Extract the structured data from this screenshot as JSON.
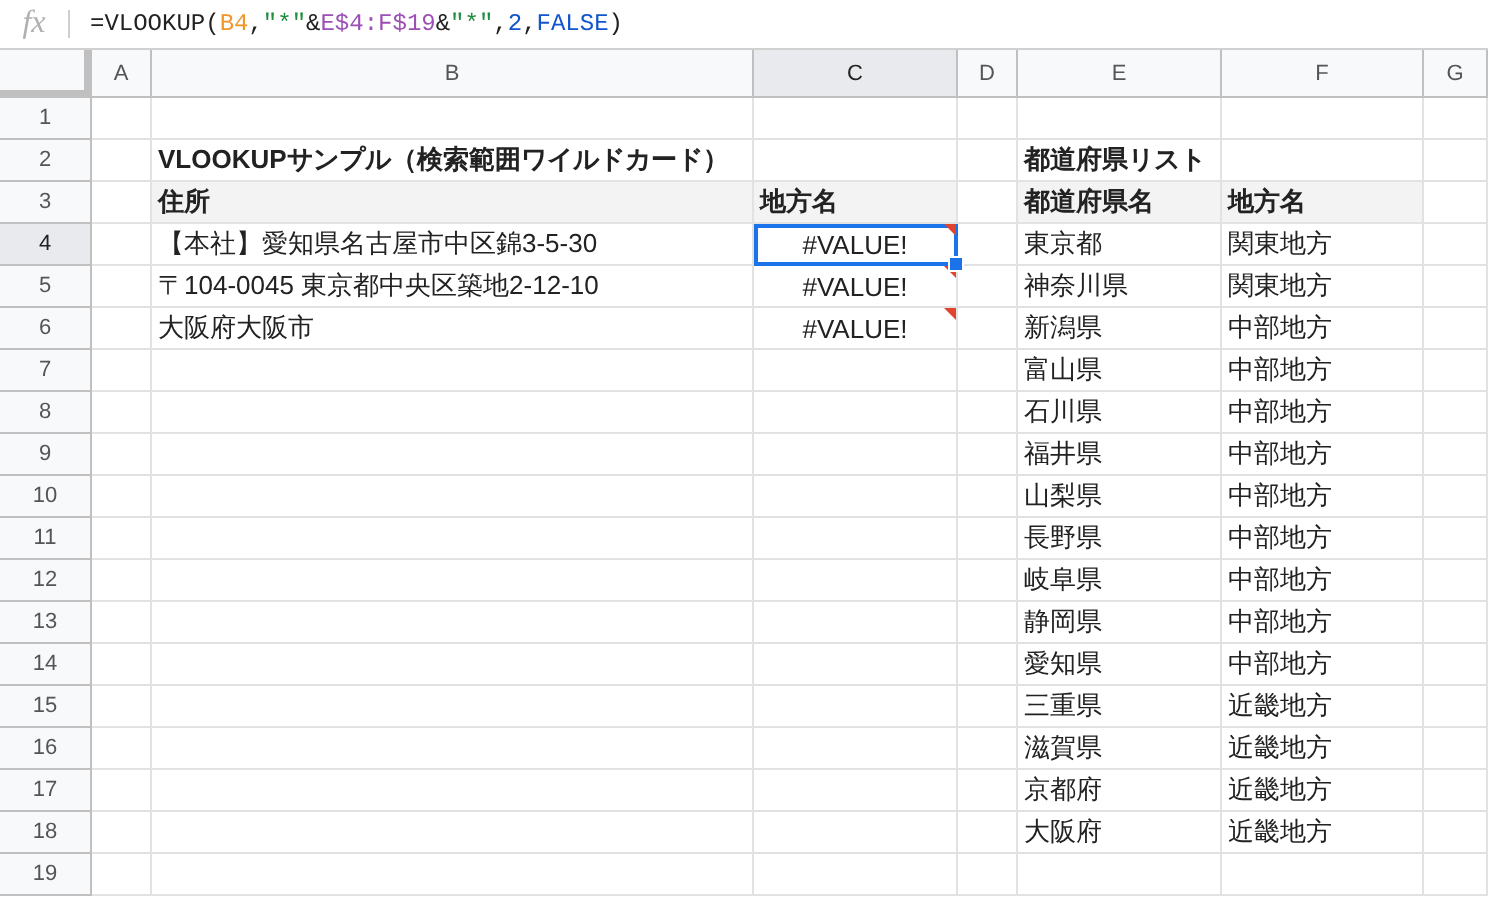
{
  "formula_bar": {
    "label": "fx",
    "tokens": [
      {
        "kind": "text",
        "text": "=VLOOKUP("
      },
      {
        "kind": "ref",
        "text": "B4",
        "color": "#f0962a"
      },
      {
        "kind": "text",
        "text": ","
      },
      {
        "kind": "string",
        "text": "\"*\""
      },
      {
        "kind": "text",
        "text": "&"
      },
      {
        "kind": "ref",
        "text": "E$4:F$19",
        "color": "#9c4fb5"
      },
      {
        "kind": "text",
        "text": "&"
      },
      {
        "kind": "string",
        "text": "\"*\""
      },
      {
        "kind": "text",
        "text": ","
      },
      {
        "kind": "number",
        "text": "2"
      },
      {
        "kind": "text",
        "text": ","
      },
      {
        "kind": "number",
        "text": "FALSE"
      },
      {
        "kind": "text",
        "text": ")"
      }
    ]
  },
  "columns": [
    {
      "label": "A",
      "selected": false
    },
    {
      "label": "B",
      "selected": false
    },
    {
      "label": "C",
      "selected": true
    },
    {
      "label": "D",
      "selected": false
    },
    {
      "label": "E",
      "selected": false
    },
    {
      "label": "F",
      "selected": false
    },
    {
      "label": "G",
      "selected": false
    }
  ],
  "rows": [
    {
      "number": "1",
      "selected": false,
      "cells": {}
    },
    {
      "number": "2",
      "selected": false,
      "cells": {
        "B": {
          "kind": "title",
          "text": "VLOOKUPサンプル（検索範囲ワイルドカード）",
          "selected": false
        },
        "E": {
          "kind": "title",
          "text": "都道府県リスト",
          "selected": false
        }
      }
    },
    {
      "number": "3",
      "selected": false,
      "cells": {
        "B": {
          "kind": "header",
          "text": "住所",
          "selected": false
        },
        "C": {
          "kind": "header",
          "text": "地方名",
          "selected": false
        },
        "E": {
          "kind": "header",
          "text": "都道府県名",
          "selected": false
        },
        "F": {
          "kind": "header",
          "text": "地方名",
          "selected": false
        }
      }
    },
    {
      "number": "4",
      "selected": true,
      "cells": {
        "B": {
          "kind": "text",
          "text": "【本社】愛知県名古屋市中区錦3-5-30",
          "selected": false
        },
        "C": {
          "kind": "error",
          "text": "#VALUE!",
          "selected": true
        },
        "E": {
          "kind": "text",
          "text": "東京都",
          "selected": false
        },
        "F": {
          "kind": "text",
          "text": "関東地方",
          "selected": false
        }
      }
    },
    {
      "number": "5",
      "selected": false,
      "cells": {
        "B": {
          "kind": "text",
          "text": "〒104-0045 東京都中央区築地2-12-10",
          "selected": false
        },
        "C": {
          "kind": "error",
          "text": "#VALUE!",
          "selected": false
        },
        "E": {
          "kind": "text",
          "text": "神奈川県",
          "selected": false
        },
        "F": {
          "kind": "text",
          "text": "関東地方",
          "selected": false
        }
      }
    },
    {
      "number": "6",
      "selected": false,
      "cells": {
        "B": {
          "kind": "text",
          "text": "大阪府大阪市",
          "selected": false
        },
        "C": {
          "kind": "error",
          "text": "#VALUE!",
          "selected": false
        },
        "E": {
          "kind": "text",
          "text": "新潟県",
          "selected": false
        },
        "F": {
          "kind": "text",
          "text": "中部地方",
          "selected": false
        }
      }
    },
    {
      "number": "7",
      "selected": false,
      "cells": {
        "E": {
          "kind": "text",
          "text": "富山県",
          "selected": false
        },
        "F": {
          "kind": "text",
          "text": "中部地方",
          "selected": false
        }
      }
    },
    {
      "number": "8",
      "selected": false,
      "cells": {
        "E": {
          "kind": "text",
          "text": "石川県",
          "selected": false
        },
        "F": {
          "kind": "text",
          "text": "中部地方",
          "selected": false
        }
      }
    },
    {
      "number": "9",
      "selected": false,
      "cells": {
        "E": {
          "kind": "text",
          "text": "福井県",
          "selected": false
        },
        "F": {
          "kind": "text",
          "text": "中部地方",
          "selected": false
        }
      }
    },
    {
      "number": "10",
      "selected": false,
      "cells": {
        "E": {
          "kind": "text",
          "text": "山梨県",
          "selected": false
        },
        "F": {
          "kind": "text",
          "text": "中部地方",
          "selected": false
        }
      }
    },
    {
      "number": "11",
      "selected": false,
      "cells": {
        "E": {
          "kind": "text",
          "text": "長野県",
          "selected": false
        },
        "F": {
          "kind": "text",
          "text": "中部地方",
          "selected": false
        }
      }
    },
    {
      "number": "12",
      "selected": false,
      "cells": {
        "E": {
          "kind": "text",
          "text": "岐阜県",
          "selected": false
        },
        "F": {
          "kind": "text",
          "text": "中部地方",
          "selected": false
        }
      }
    },
    {
      "number": "13",
      "selected": false,
      "cells": {
        "E": {
          "kind": "text",
          "text": "静岡県",
          "selected": false
        },
        "F": {
          "kind": "text",
          "text": "中部地方",
          "selected": false
        }
      }
    },
    {
      "number": "14",
      "selected": false,
      "cells": {
        "E": {
          "kind": "text",
          "text": "愛知県",
          "selected": false
        },
        "F": {
          "kind": "text",
          "text": "中部地方",
          "selected": false
        }
      }
    },
    {
      "number": "15",
      "selected": false,
      "cells": {
        "E": {
          "kind": "text",
          "text": "三重県",
          "selected": false
        },
        "F": {
          "kind": "text",
          "text": "近畿地方",
          "selected": false
        }
      }
    },
    {
      "number": "16",
      "selected": false,
      "cells": {
        "E": {
          "kind": "text",
          "text": "滋賀県",
          "selected": false
        },
        "F": {
          "kind": "text",
          "text": "近畿地方",
          "selected": false
        }
      }
    },
    {
      "number": "17",
      "selected": false,
      "cells": {
        "E": {
          "kind": "text",
          "text": "京都府",
          "selected": false
        },
        "F": {
          "kind": "text",
          "text": "近畿地方",
          "selected": false
        }
      }
    },
    {
      "number": "18",
      "selected": false,
      "cells": {
        "E": {
          "kind": "text",
          "text": "大阪府",
          "selected": false
        },
        "F": {
          "kind": "text",
          "text": "近畿地方",
          "selected": false
        }
      }
    },
    {
      "number": "19",
      "selected": false,
      "cells": {}
    }
  ]
}
